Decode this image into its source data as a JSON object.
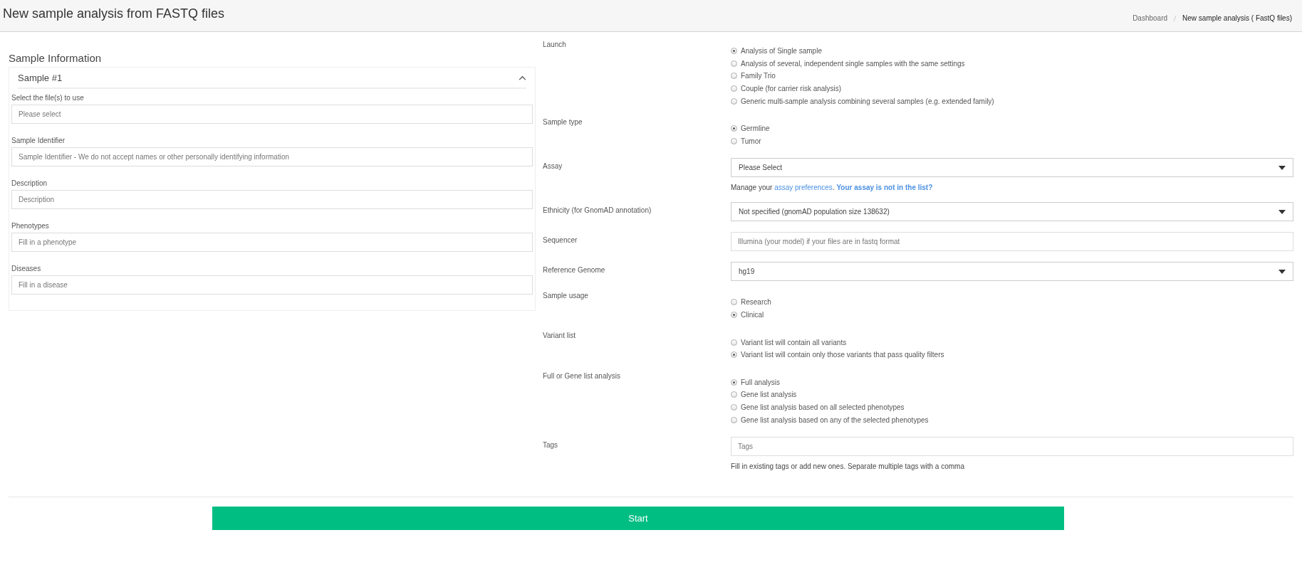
{
  "header": {
    "title": "New sample analysis from FASTQ files",
    "breadcrumbs": [
      {
        "label": "Dashboard",
        "kind": "link"
      },
      {
        "label": "New sample analysis ( FastQ files)",
        "kind": "current"
      }
    ]
  },
  "sample_info": {
    "heading": "Sample Information",
    "panel": {
      "title": "Sample #1",
      "expanded": true,
      "fields": [
        {
          "label": "Select the file(s) to use",
          "placeholder": "Please select"
        },
        {
          "label": "Sample Identifier",
          "placeholder": "Sample Identifier - We do not accept names or other personally identifying information"
        },
        {
          "label": "Description",
          "placeholder": "Description"
        },
        {
          "label": "Phenotypes",
          "placeholder": "Fill in a phenotype"
        },
        {
          "label": "Diseases",
          "placeholder": "Fill in a disease"
        }
      ]
    }
  },
  "settings": [
    {
      "label": "Launch",
      "kind": "radio",
      "options": [
        {
          "label": "Analysis of Single sample",
          "selected": true
        },
        {
          "label": "Analysis of several, independent single samples with the same settings",
          "selected": false
        },
        {
          "label": "Family Trio",
          "selected": false
        },
        {
          "label": "Couple (for carrier risk analysis)",
          "selected": false
        },
        {
          "label": "Generic multi-sample analysis combining several samples (e.g. extended family)",
          "selected": false
        }
      ]
    },
    {
      "label": "Sample type",
      "kind": "radio",
      "options": [
        {
          "label": "Germline",
          "selected": true
        },
        {
          "label": "Tumor",
          "selected": false
        }
      ]
    },
    {
      "label": "Assay",
      "kind": "select",
      "value": "Please Select",
      "help": [
        {
          "text": "Manage your ",
          "kind": "text"
        },
        {
          "text": "assay preferences",
          "kind": "link"
        },
        {
          "text": ". ",
          "kind": "text"
        },
        {
          "text": "Your assay is not in the list?",
          "kind": "bold-link"
        }
      ]
    },
    {
      "label": "Ethnicity (for GnomAD annotation)",
      "kind": "select",
      "value": "Not specified (gnomAD population size 138632)"
    },
    {
      "label": "Sequencer",
      "kind": "input",
      "placeholder": "Illumina (your model) if your files are in fastq format"
    },
    {
      "label": "Reference Genome",
      "kind": "select",
      "value": "hg19"
    },
    {
      "label": "Sample usage",
      "kind": "radio",
      "options": [
        {
          "label": "Research",
          "selected": false
        },
        {
          "label": "Clinical",
          "selected": true
        }
      ]
    },
    {
      "label": "Variant list",
      "kind": "radio",
      "options": [
        {
          "label": "Variant list will contain all variants",
          "selected": false
        },
        {
          "label": "Variant list will contain only those variants that pass quality filters",
          "selected": true
        }
      ]
    },
    {
      "label": "Full or Gene list analysis",
      "kind": "radio",
      "options": [
        {
          "label": "Full analysis",
          "selected": true
        },
        {
          "label": "Gene list analysis",
          "selected": false
        },
        {
          "label": "Gene list analysis based on all selected phenotypes",
          "selected": false
        },
        {
          "label": "Gene list analysis based on any of the selected phenotypes",
          "selected": false
        }
      ]
    },
    {
      "label": "Tags",
      "kind": "input",
      "placeholder": "Tags",
      "help": [
        {
          "text": "Fill in existing tags or add new ones. Separate multiple tags with a comma",
          "kind": "text"
        }
      ]
    }
  ],
  "start_button": "Start"
}
